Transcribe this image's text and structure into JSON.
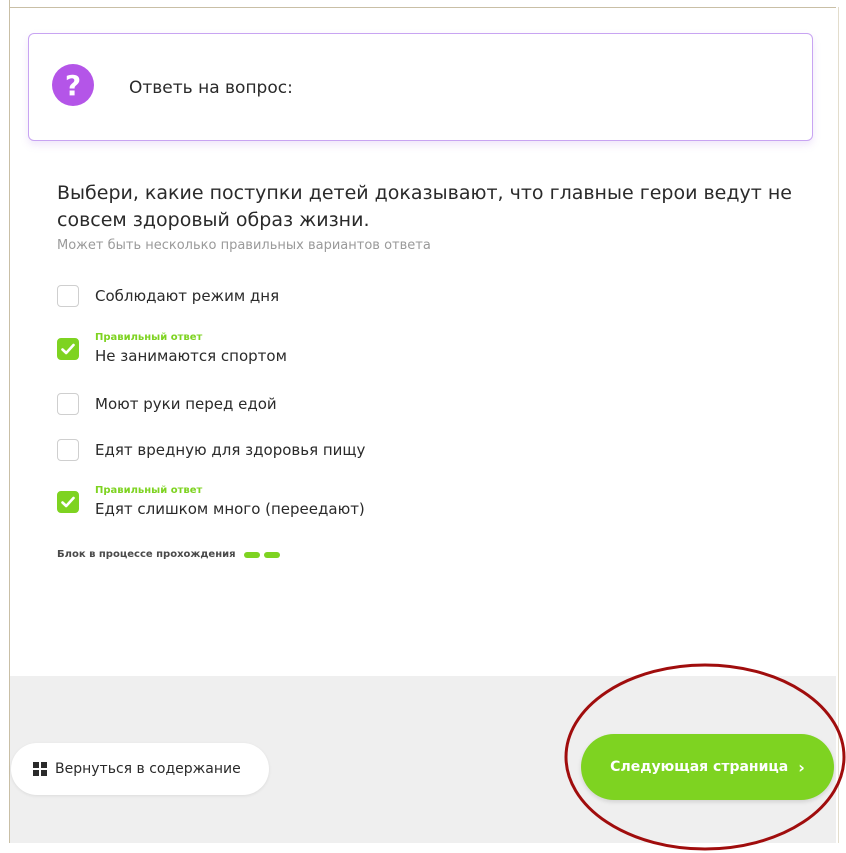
{
  "question_card": {
    "title": "Ответь на вопрос:",
    "icon": "question-mark-icon",
    "icon_color": "#b455e8",
    "border_color": "#c8a4f2"
  },
  "question": {
    "prompt": "Выбери, какие поступки детей доказывают, что главные герои ведут не совсем здоровый образ жизни.",
    "hint": "Может быть несколько правильных вариантов ответа"
  },
  "options": [
    {
      "label": "Соблюдают режим дня",
      "checked": false,
      "correct_label": ""
    },
    {
      "label": "Не занимаются спортом",
      "checked": true,
      "correct_label": "Правильный ответ"
    },
    {
      "label": "Моют руки перед едой",
      "checked": false,
      "correct_label": ""
    },
    {
      "label": "Едят вредную для здоровья пищу",
      "checked": false,
      "correct_label": ""
    },
    {
      "label": "Едят слишком много (переедают)",
      "checked": true,
      "correct_label": "Правильный ответ"
    }
  ],
  "progress": {
    "label": "Блок в процессе прохождения",
    "segments": 2,
    "color": "#7ed321"
  },
  "footer": {
    "back_label": "Вернуться в содержание",
    "next_label": "Следующая страница",
    "next_icon": "chevron-right-icon",
    "back_icon": "grid-icon",
    "accent_color": "#7ed321"
  },
  "annotation": {
    "color": "#a00d0d",
    "shape": "ellipse"
  }
}
